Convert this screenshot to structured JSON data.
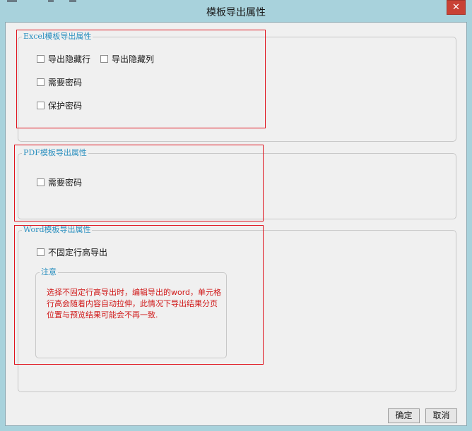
{
  "window": {
    "title": "模板导出属性",
    "close_glyph": "✕"
  },
  "excel_group": {
    "legend": "Excel模板导出属性",
    "export_hidden_rows": "导出隐藏行",
    "export_hidden_cols": "导出隐藏列",
    "require_password": "需要密码",
    "protect_password": "保护密码"
  },
  "pdf_group": {
    "legend": "PDF模板导出属性",
    "require_password": "需要密码"
  },
  "word_group": {
    "legend": "Word模板导出属性",
    "non_fixed_row_height": "不固定行高导出",
    "note_legend": "注意",
    "note_text": "选择不固定行高导出时，编辑导出的word，单元格行高会随着内容自动拉伸，此情况下导出结果分页位置与预览结果可能会不再一致."
  },
  "buttons": {
    "ok": "确定",
    "cancel": "取消"
  },
  "colors": {
    "title_bar": "#a8d2dc",
    "close_button": "#c84235",
    "legend_text": "#2a8fbf",
    "note_text": "#d01818",
    "highlight_box": "#e0141e"
  },
  "icons": {
    "close": "close-icon",
    "checkbox": "checkbox-unchecked-icon"
  }
}
